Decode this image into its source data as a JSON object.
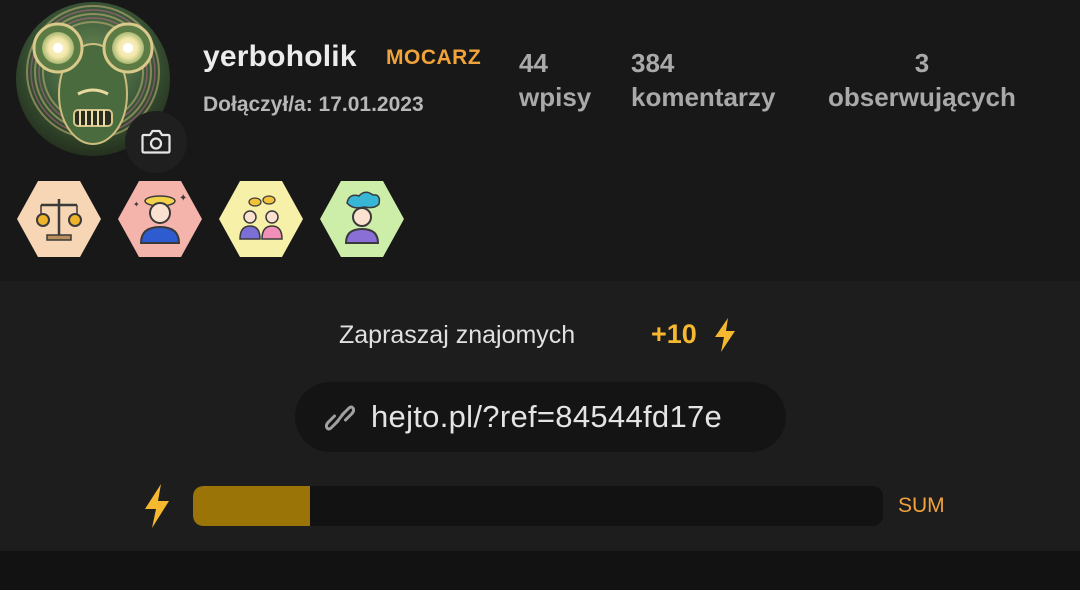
{
  "profile": {
    "username": "yerboholik",
    "rank": "MOCARZ",
    "joined": "Dołączył/a: 17.01.2023",
    "stats": [
      {
        "value": "44",
        "label": "wpisy"
      },
      {
        "value": "384",
        "label": "komentarzy"
      },
      {
        "value": "3",
        "label": "obserwujących"
      }
    ],
    "badges": [
      {
        "icon": "scales-of-justice-icon",
        "bg": "#f6d6b5"
      },
      {
        "icon": "dizzy-person-icon",
        "bg": "#f5b4ab"
      },
      {
        "icon": "two-people-chatting-icon",
        "bg": "#f7f0a8"
      },
      {
        "icon": "person-with-thought-cloud-icon",
        "bg": "#cdeea8"
      }
    ]
  },
  "invite": {
    "title": "Zapraszaj znajomych",
    "bonus": "+10",
    "ref_link": "hejto.pl/?ref=84544fd17e",
    "progress_fraction": 0.17,
    "sum_label": "SUM"
  },
  "colors": {
    "accent_orange": "#f0a23b",
    "accent_yellow": "#f5b82e",
    "progress_fill": "#9a7406"
  }
}
